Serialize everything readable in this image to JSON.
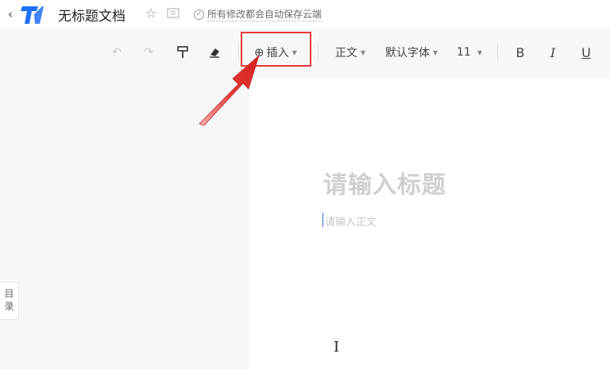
{
  "header": {
    "back_icon": "chevron-left-icon",
    "logo_icon": "tencent-docs-logo",
    "title": "无标题文档",
    "star_icon": "star-icon",
    "folder_icon": "folder-icon",
    "save_status": "所有修改都会自动保存云端"
  },
  "toolbar": {
    "undo_icon": "undo-icon",
    "redo_icon": "redo-icon",
    "format_painter_icon": "format-painter-icon",
    "eraser_icon": "eraser-icon",
    "insert_label": "插入",
    "style_label": "正文",
    "font_label": "默认字体",
    "size_label": "11",
    "bold_label": "B",
    "italic_label": "I",
    "underline_label": "U"
  },
  "sidebar": {
    "toc_label_1": "目",
    "toc_label_2": "录"
  },
  "editor": {
    "title_placeholder": "请输入标题",
    "body_placeholder": "请输入正文"
  },
  "colors": {
    "highlight": "#e53935",
    "brand_blue": "#1e6fff"
  }
}
